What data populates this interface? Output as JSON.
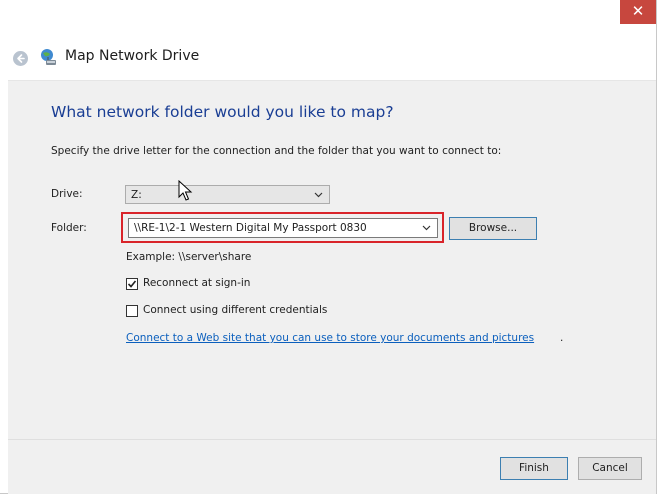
{
  "window": {
    "title": "Map Network Drive",
    "close_glyph": "✕"
  },
  "heading": "What network folder would you like to map?",
  "instruction": "Specify the drive letter for the connection and the folder that you want to connect to:",
  "drive": {
    "label": "Drive:",
    "value": "Z:"
  },
  "folder": {
    "label": "Folder:",
    "value": "\\\\RE-1\\2-1 Western Digital My Passport 0830",
    "browse_label": "Browse..."
  },
  "example": "Example: \\\\server\\share",
  "options": {
    "reconnect": {
      "label": "Reconnect at sign-in",
      "checked": true
    },
    "different_credentials": {
      "label": "Connect using different credentials",
      "checked": false
    }
  },
  "link": {
    "text": "Connect to a Web site that you can use to store your documents and pictures",
    "trailing": "."
  },
  "footer": {
    "finish_label": "Finish",
    "cancel_label": "Cancel"
  },
  "colors": {
    "heading": "#1a3e94",
    "link": "#0b5fbd",
    "highlight": "#d9242a",
    "close": "#c7473e"
  },
  "icons": {
    "back": "back-arrow-icon",
    "app": "network-drive-icon",
    "chevron": "chevron-down-icon",
    "check": "checkmark-icon",
    "cursor": "mouse-pointer-icon"
  }
}
